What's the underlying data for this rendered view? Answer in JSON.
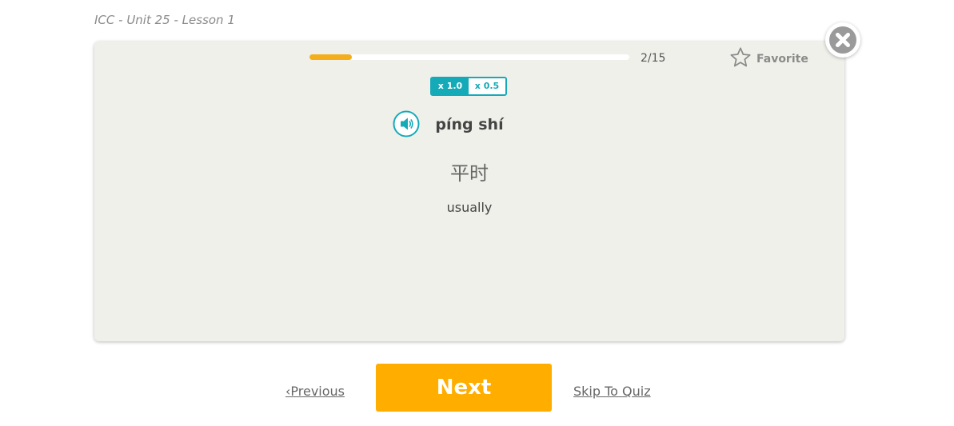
{
  "breadcrumb": "ICC - Unit 25 - Lesson 1",
  "progress": {
    "current": 2,
    "total": 15,
    "label": "2/15",
    "fraction": 0.133
  },
  "favorite": {
    "label": "Favorite",
    "icon": "star-outline-icon"
  },
  "speed": {
    "options": [
      "x 1.0",
      "x 0.5"
    ],
    "selected": "x 1.0"
  },
  "word": {
    "pinyin": "píng shí",
    "hanzi": "平时",
    "meaning": "usually"
  },
  "nav": {
    "previous": "‹Previous",
    "next": "Next",
    "skip": "Skip To Quiz"
  },
  "colors": {
    "accent": "#15aab8",
    "primary_button": "#ffae00",
    "progress": "#f5ae1b",
    "card_bg": "#f0f0eb"
  }
}
